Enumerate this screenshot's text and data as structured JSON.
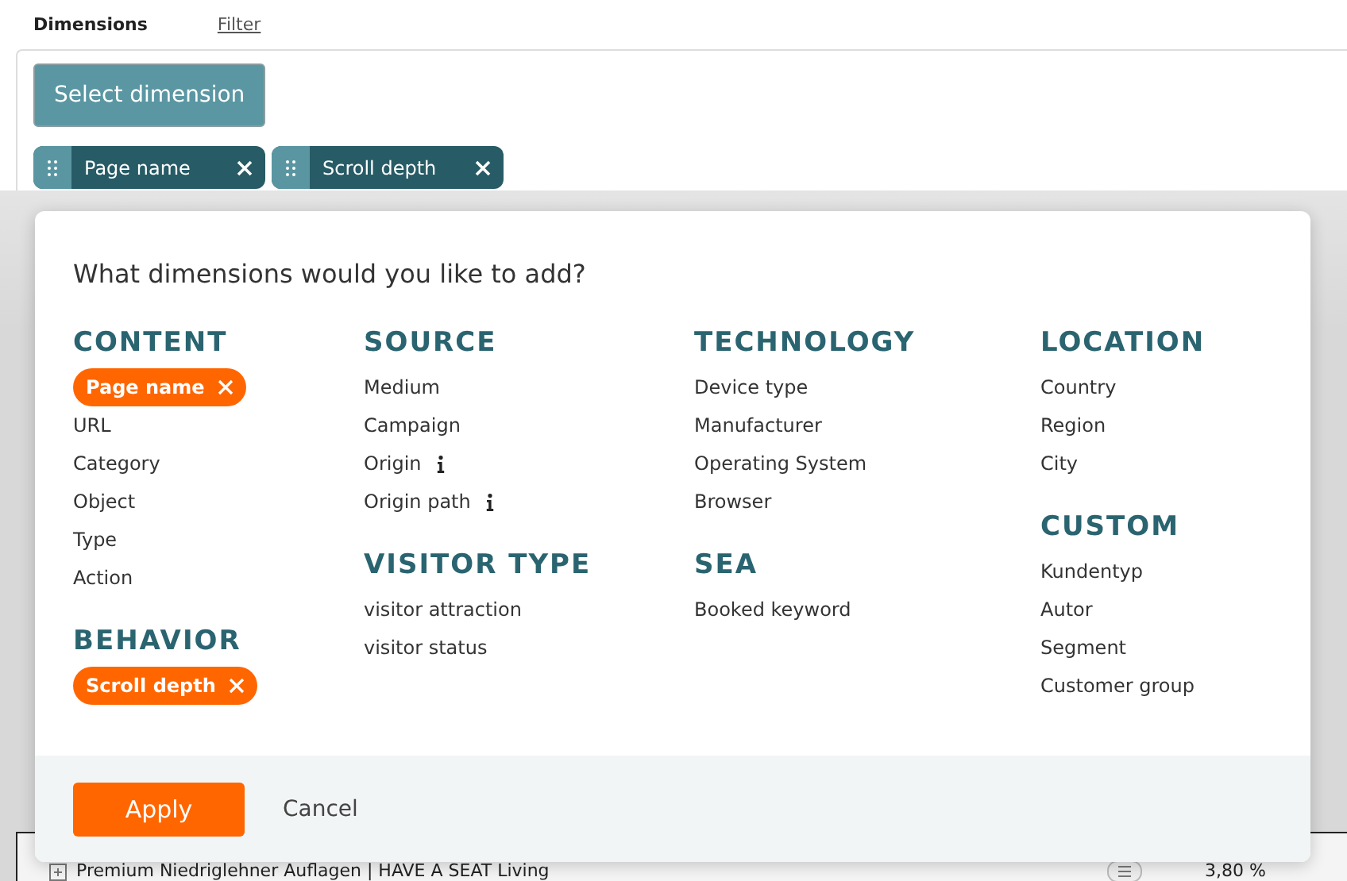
{
  "tabs": [
    {
      "label": "Dimensions",
      "selected": true
    },
    {
      "label": "Filter",
      "selected": false
    }
  ],
  "select_button": "Select dimension",
  "chips": [
    {
      "label": "Page name"
    },
    {
      "label": "Scroll depth"
    }
  ],
  "background_row": {
    "label": "Premium Niedriglehner Auflagen | HAVE A SEAT Living",
    "value": "3,80 %"
  },
  "modal": {
    "title": "What dimensions would you like to add?",
    "columns": [
      [
        {
          "title": "CONTENT",
          "items": [
            {
              "label": "Page name",
              "selected": true
            },
            {
              "label": "URL",
              "selected": false
            },
            {
              "label": "Category",
              "selected": false
            },
            {
              "label": "Object",
              "selected": false
            },
            {
              "label": "Type",
              "selected": false
            },
            {
              "label": "Action",
              "selected": false
            }
          ]
        },
        {
          "title": "BEHAVIOR",
          "items": [
            {
              "label": "Scroll depth",
              "selected": true
            }
          ]
        }
      ],
      [
        {
          "title": "SOURCE",
          "items": [
            {
              "label": "Medium",
              "selected": false
            },
            {
              "label": "Campaign",
              "selected": false
            },
            {
              "label": "Origin",
              "selected": false,
              "info": true
            },
            {
              "label": "Origin path",
              "selected": false,
              "info": true
            }
          ]
        },
        {
          "title": "VISITOR TYPE",
          "items": [
            {
              "label": "visitor attraction",
              "selected": false
            },
            {
              "label": "visitor status",
              "selected": false
            }
          ]
        }
      ],
      [
        {
          "title": "TECHNOLOGY",
          "items": [
            {
              "label": "Device type",
              "selected": false
            },
            {
              "label": "Manufacturer",
              "selected": false
            },
            {
              "label": "Operating System",
              "selected": false
            },
            {
              "label": "Browser",
              "selected": false
            }
          ]
        },
        {
          "title": "SEA",
          "items": [
            {
              "label": "Booked keyword",
              "selected": false
            }
          ]
        }
      ],
      [
        {
          "title": "LOCATION",
          "items": [
            {
              "label": "Country",
              "selected": false
            },
            {
              "label": "Region",
              "selected": false
            },
            {
              "label": "City",
              "selected": false
            }
          ]
        },
        {
          "title": "CUSTOM",
          "items": [
            {
              "label": "Kundentyp",
              "selected": false
            },
            {
              "label": "Autor",
              "selected": false
            },
            {
              "label": "Segment",
              "selected": false
            },
            {
              "label": "Customer group",
              "selected": false
            }
          ]
        }
      ]
    ],
    "apply": "Apply",
    "cancel": "Cancel"
  }
}
